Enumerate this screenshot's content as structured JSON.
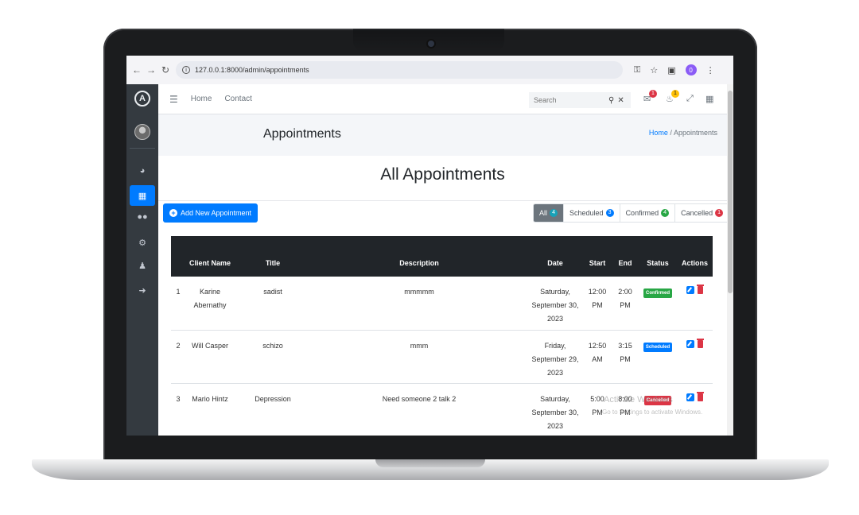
{
  "browser": {
    "url": "127.0.0.1:8000/admin/appointments",
    "profile_initial": "0"
  },
  "topnav": {
    "links": [
      "Home",
      "Contact"
    ],
    "search_placeholder": "Search",
    "messages_count": "1",
    "notifications_count": "1"
  },
  "sidebar": {
    "logo_letter": "A",
    "items": [
      {
        "icon": "dashboard-icon",
        "active": false
      },
      {
        "icon": "calendar-icon",
        "active": true
      },
      {
        "icon": "users-icon",
        "active": false
      },
      {
        "icon": "gear-icon",
        "active": false
      },
      {
        "icon": "user-icon",
        "active": false
      },
      {
        "icon": "sign-out-icon",
        "active": false
      }
    ]
  },
  "header": {
    "title": "Appointments",
    "breadcrumb_home": "Home",
    "breadcrumb_sep": "/",
    "breadcrumb_current": "Appointments"
  },
  "card": {
    "title": "All Appointments",
    "add_button": "Add New Appointment",
    "filters": [
      {
        "label": "All",
        "count": "4",
        "color": "#17a2b8",
        "active": true
      },
      {
        "label": "Scheduled",
        "count": "3",
        "color": "#007bff",
        "active": false
      },
      {
        "label": "Confirmed",
        "count": "4",
        "color": "#28a745",
        "active": false
      },
      {
        "label": "Cancelled",
        "count": "1",
        "color": "#dc3545",
        "active": false
      }
    ]
  },
  "table": {
    "headers": [
      "",
      "Client Name",
      "Title",
      "Description",
      "Date",
      "Start",
      "End",
      "Status",
      "Actions"
    ],
    "rows": [
      {
        "num": "1",
        "client": "Karine Abernathy",
        "title": "sadist",
        "description": "mmmmm",
        "date": "Saturday, September 30, 2023",
        "start": "12:00 PM",
        "end": "2:00 PM",
        "status": "Confirmed",
        "status_color": "#28a745"
      },
      {
        "num": "2",
        "client": "Will Casper",
        "title": "schizo",
        "description": "mmm",
        "date": "Friday, September 29, 2023",
        "start": "12:50 AM",
        "end": "3:15 PM",
        "status": "Scheduled",
        "status_color": "#007bff"
      },
      {
        "num": "3",
        "client": "Mario Hintz",
        "title": "Depression",
        "description": "Need someone 2 talk 2",
        "date": "Saturday, September 30, 2023",
        "start": "5:00 PM",
        "end": "8:00 PM",
        "status": "Cancelled",
        "status_color": "#dc3545"
      }
    ]
  },
  "watermark": {
    "line1": "Activate Windows",
    "line2": "Go to Settings to activate Windows."
  }
}
